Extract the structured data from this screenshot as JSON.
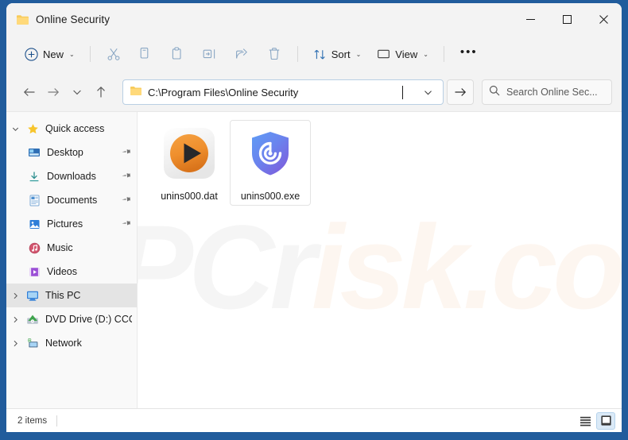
{
  "window": {
    "title": "Online Security",
    "title_icon": "folder-icon",
    "controls": {
      "minimize": "–",
      "maximize": "☐",
      "close": "✕"
    }
  },
  "toolbar": {
    "new_label": "New",
    "new_icon": "plus-circle-icon",
    "cut_icon": "scissors-icon",
    "copy_icon": "copy-icon",
    "paste_icon": "clipboard-icon",
    "rename_icon": "rename-icon",
    "share_icon": "share-icon",
    "delete_icon": "trash-icon",
    "sort_label": "Sort",
    "sort_icon": "sort-arrows-icon",
    "view_label": "View",
    "view_icon": "monitor-icon",
    "more_label": "•••",
    "chevron": "⌄"
  },
  "navigation": {
    "back_icon": "arrow-left-icon",
    "forward_icon": "arrow-right-icon",
    "recent_icon": "chevron-down-icon",
    "up_icon": "arrow-up-icon",
    "address_value": "C:\\Program Files\\Online Security",
    "address_icon": "folder-icon",
    "address_dropdown_icon": "chevron-down-icon",
    "go_icon": "arrow-right-icon",
    "search_placeholder": "Search Online Sec...",
    "search_icon": "search-icon"
  },
  "sidebar": {
    "items": [
      {
        "label": "Quick access",
        "icon": "star-icon",
        "expander": "⌄",
        "expanded": true,
        "indent": false,
        "pinned": false,
        "selected": false
      },
      {
        "label": "Desktop",
        "icon": "desktop-icon",
        "expander": "",
        "indent": true,
        "pinned": true,
        "selected": false
      },
      {
        "label": "Downloads",
        "icon": "downloads-icon",
        "expander": "",
        "indent": true,
        "pinned": true,
        "selected": false
      },
      {
        "label": "Documents",
        "icon": "documents-icon",
        "expander": "",
        "indent": true,
        "pinned": true,
        "selected": false
      },
      {
        "label": "Pictures",
        "icon": "pictures-icon",
        "expander": "",
        "indent": true,
        "pinned": true,
        "selected": false
      },
      {
        "label": "Music",
        "icon": "music-icon",
        "expander": "",
        "indent": true,
        "pinned": false,
        "selected": false
      },
      {
        "label": "Videos",
        "icon": "videos-icon",
        "expander": "",
        "indent": true,
        "pinned": false,
        "selected": false
      },
      {
        "label": "This PC",
        "icon": "this-pc-icon",
        "expander": "›",
        "indent": false,
        "pinned": false,
        "selected": true
      },
      {
        "label": "DVD Drive (D:) CCCC",
        "icon": "dvd-drive-icon",
        "expander": "›",
        "indent": false,
        "pinned": false,
        "selected": false
      },
      {
        "label": "Network",
        "icon": "network-icon",
        "expander": "›",
        "indent": false,
        "pinned": false,
        "selected": false
      }
    ],
    "pin_glyph": "📌"
  },
  "files": [
    {
      "name": "unins000.dat",
      "icon": "media-player-file-icon",
      "hovered": false
    },
    {
      "name": "unins000.exe",
      "icon": "shield-app-icon",
      "hovered": true
    }
  ],
  "statusbar": {
    "item_count": "2 items",
    "list_view_icon": "list-view-icon",
    "large_icons_view_icon": "large-icons-view-icon",
    "active_view": "large-icons"
  },
  "watermark": {
    "text_part_a": "PCr",
    "text_part_b": "isk.com"
  },
  "colors": {
    "desktop_blue": "#215c9c",
    "window_chrome": "#f3f3f3",
    "accent_blue": "#0f6cbd",
    "selection_gray": "#e4e4e4",
    "orange_icon": "#ee8f2d",
    "shield_blue": "#5b8cf0",
    "shield_purple": "#7b5bd6"
  }
}
